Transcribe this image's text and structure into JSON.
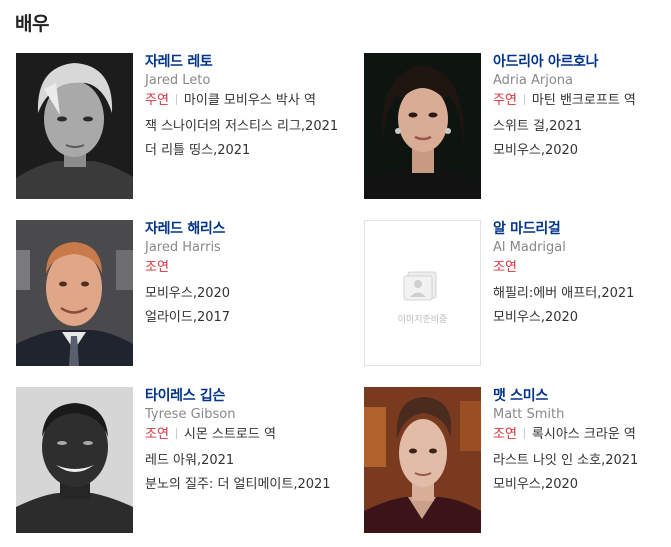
{
  "section": {
    "title": "배우"
  },
  "actors": [
    {
      "name_ko": "자레드 레토",
      "name_en": "Jared Leto",
      "role_type": "주연",
      "role_name": "마이클 모비우스 박사 역",
      "works": [
        "잭 스나이더의 저스티스 리그,2021",
        "더 리틀 띵스,2021"
      ]
    },
    {
      "name_ko": "아드리아 아르호나",
      "name_en": "Adria Arjona",
      "role_type": "주연",
      "role_name": "마틴 밴크로프트 역",
      "works": [
        "스위트 걸,2021",
        "모비우스,2020"
      ]
    },
    {
      "name_ko": "자레드 해리스",
      "name_en": "Jared Harris",
      "role_type": "조연",
      "role_name": "",
      "works": [
        "모비우스,2020",
        "얼라이드,2017"
      ]
    },
    {
      "name_ko": "알 마드리걸",
      "name_en": "Al Madrigal",
      "role_type": "조연",
      "role_name": "",
      "works": [
        "해필리:에버 애프터,2021",
        "모비우스,2020"
      ],
      "placeholder_text": "이미지준비중"
    },
    {
      "name_ko": "타이레스 깁슨",
      "name_en": "Tyrese Gibson",
      "role_type": "조연",
      "role_name": "시몬 스트로드 역",
      "works": [
        "레드 아워,2021",
        "분노의 질주: 더 얼티메이트,2021"
      ]
    },
    {
      "name_ko": "맷 스미스",
      "name_en": "Matt Smith",
      "role_type": "조연",
      "role_name": "록시아스 크라운 역",
      "works": [
        "라스트 나잇 인 소호,2021",
        "모비우스,2020"
      ]
    }
  ],
  "colors": {
    "name_link": "#00338a",
    "role_type": "#d7323a",
    "english_name": "#888888"
  }
}
